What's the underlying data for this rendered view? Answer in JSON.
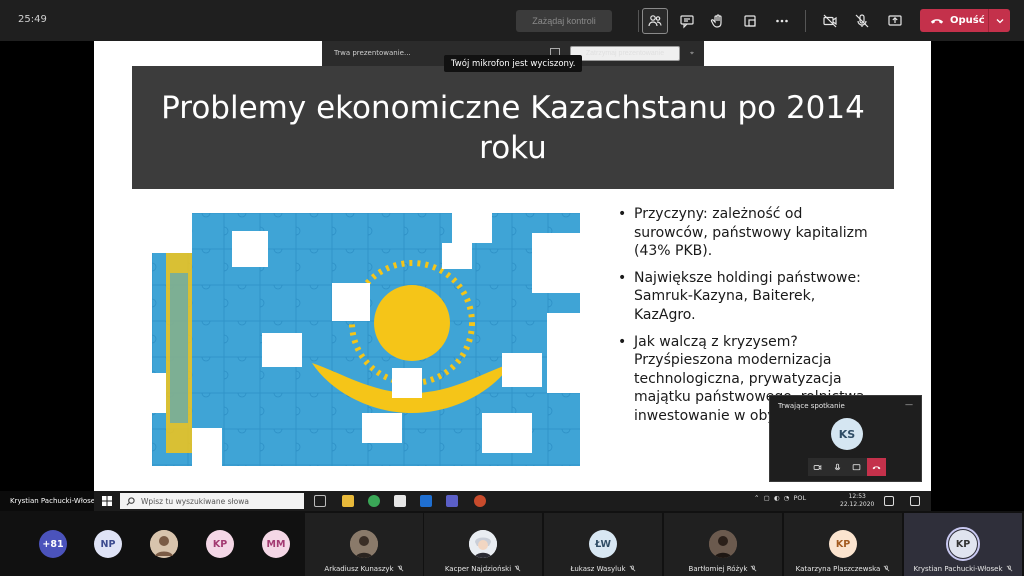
{
  "topbar": {
    "timer": "25:49",
    "take_control": "Zażądaj kontroli",
    "leave_label": "Opuść",
    "icons": [
      "participants-icon",
      "chat-icon",
      "raise-hand-icon",
      "rooms-icon",
      "more-icon",
      "camera-off-icon",
      "mic-off-icon",
      "share-icon"
    ]
  },
  "presenting_bar": {
    "status": "Trwa prezentowanie...",
    "stop_label": "Zatrzymaj prezentowanie"
  },
  "tooltip": "Twój mikrofon jest wyciszony.",
  "slide": {
    "title": "Problemy ekonomiczne Kazachstanu po 2014 roku",
    "bullets": [
      "Przyczyny: zależność od surowców, państwowy kapitalizm (43% PKB).",
      "Największe holdingi państwowe: Samruk-Kazyna, Baiterek, KazAgro.",
      "Jak walczą z kryzysem? Przyśpieszona modernizacja technologiczna, prywatyzacja majątku państwowego, rolnictwa, inwestowanie w obywateli"
    ]
  },
  "call_monitor": {
    "title": "Trwające spotkanie",
    "initials": "KS"
  },
  "taskbar": {
    "presenter": "Krystian Pachucki-Włosek",
    "search_placeholder": "Wpisz tu wyszukiwane słowa",
    "lang": "POL",
    "time": "12:53",
    "date": "22.12.2020"
  },
  "gallery": {
    "overflow": "+81",
    "circles": [
      {
        "initials": "NP",
        "bg": "#dfe3f6",
        "fg": "#3b4a8f"
      },
      {
        "initials": "",
        "bg": "#c9a98a",
        "fg": "#333"
      },
      {
        "initials": "KP",
        "bg": "#f4d7e6",
        "fg": "#a33a72"
      },
      {
        "initials": "MM",
        "bg": "#f4d7e6",
        "fg": "#a33a72"
      }
    ],
    "tiles": [
      {
        "name": "Arkadiusz Kunaszyk",
        "initials": "",
        "bg": "#8a7a6a",
        "fg": "#fff"
      },
      {
        "name": "Kacper Najdzioński",
        "initials": "",
        "bg": "#e9edf2",
        "fg": "#333"
      },
      {
        "name": "Łukasz Wasyluk",
        "initials": "ŁW",
        "bg": "#d8e7f3",
        "fg": "#2f4d66"
      },
      {
        "name": "Bartłomiej Różyk",
        "initials": "",
        "bg": "#6b5a4e",
        "fg": "#fff"
      },
      {
        "name": "Katarzyna Plaszczewska",
        "initials": "KP",
        "bg": "#fbe4cf",
        "fg": "#a35a1f"
      },
      {
        "name": "Krystian Pachucki-Włosek",
        "initials": "KP",
        "bg": "#e0e4ef",
        "fg": "#333"
      }
    ]
  }
}
